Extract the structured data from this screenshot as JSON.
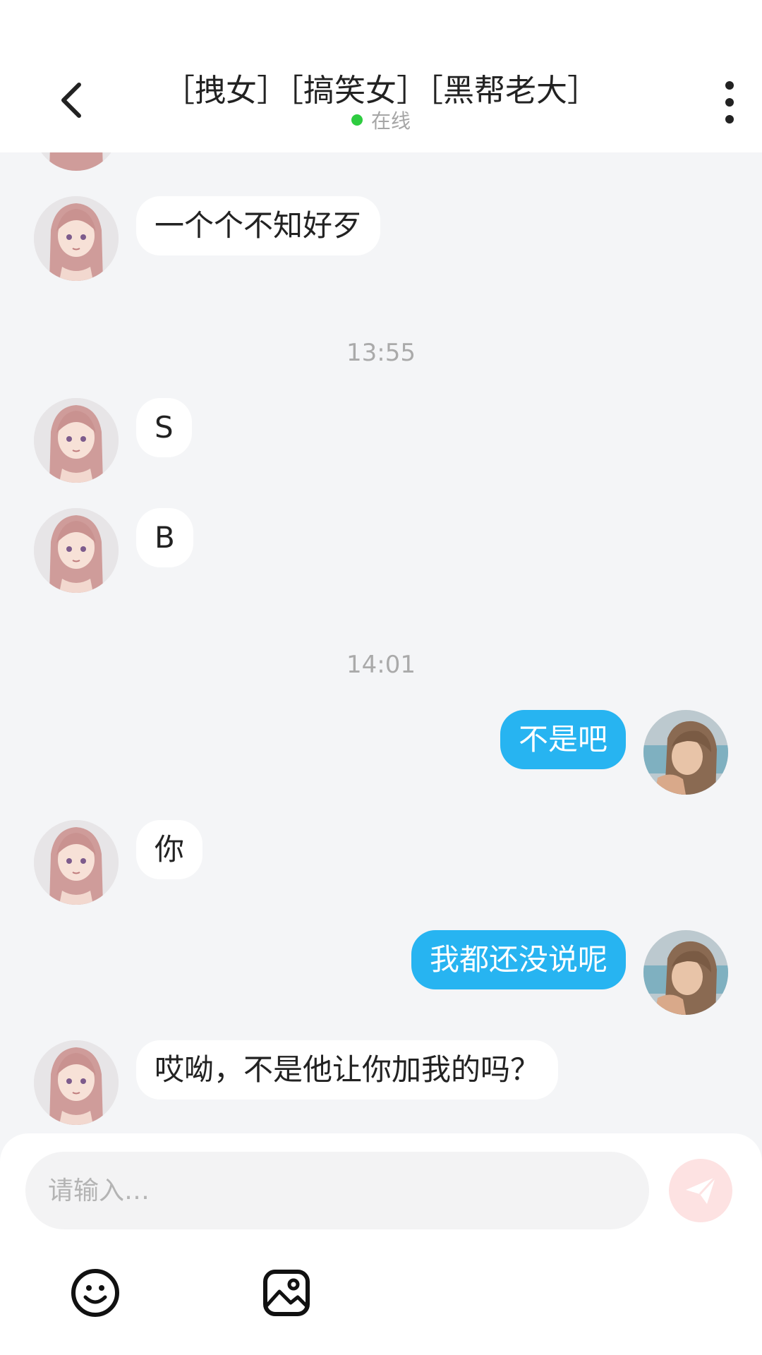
{
  "header": {
    "title": "［拽女］［搞笑女］［黑帮老大］",
    "status": "在线",
    "status_color": "#2ecc40"
  },
  "messages": [
    {
      "type": "in",
      "text": "一个个不知好歹"
    },
    {
      "type": "time",
      "text": "13:55"
    },
    {
      "type": "in",
      "text": "S"
    },
    {
      "type": "in",
      "text": "B"
    },
    {
      "type": "time",
      "text": "14:01"
    },
    {
      "type": "out",
      "text": "不是吧"
    },
    {
      "type": "in",
      "text": "你"
    },
    {
      "type": "out",
      "text": "我都还没说呢"
    },
    {
      "type": "in",
      "text": "哎呦，不是他让你加我的吗？"
    }
  ],
  "composer": {
    "placeholder": "请输入…",
    "send_icon": "paper-plane-icon",
    "tools": [
      "emoji-icon",
      "image-icon"
    ]
  },
  "colors": {
    "outgoing_bubble": "#27b4f1",
    "incoming_bubble": "#ffffff",
    "chat_background": "#f4f5f7",
    "send_button": "#fde2e2"
  }
}
